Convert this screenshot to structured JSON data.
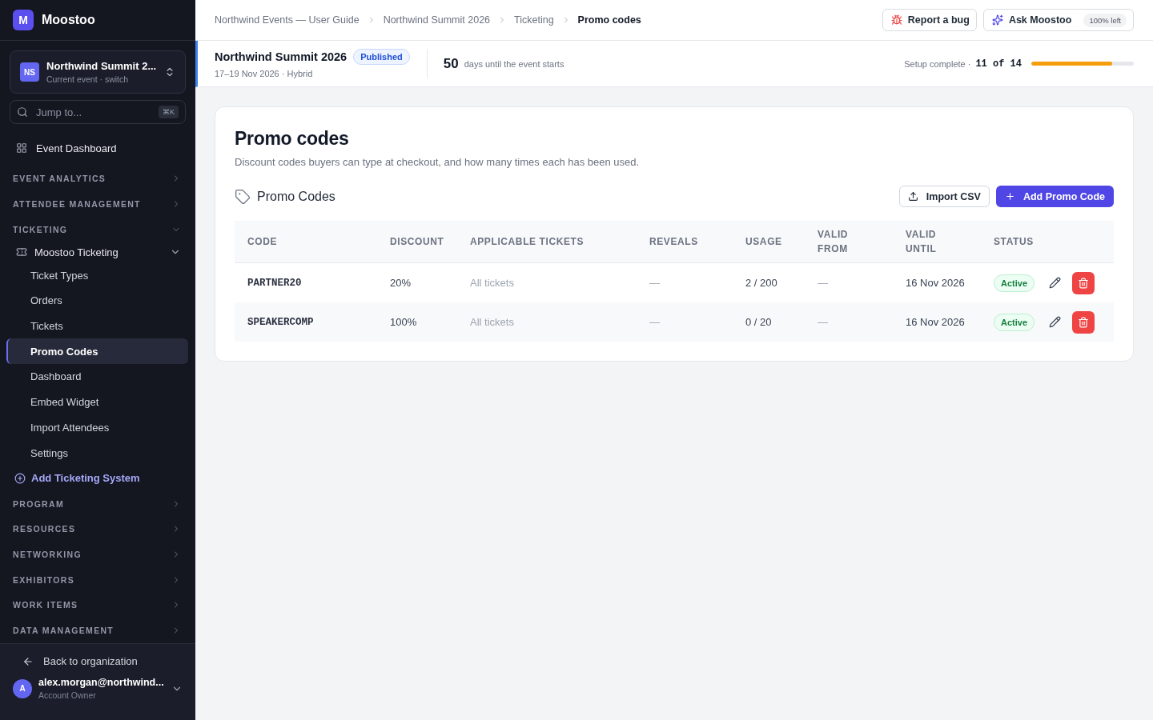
{
  "sidebar": {
    "brand": {
      "initial": "M",
      "name": "Moostoo"
    },
    "event_switcher": {
      "initials": "NS",
      "name": "Northwind Summit 2...",
      "caption": "Current event · switch"
    },
    "search": {
      "placeholder": "Jump to...",
      "shortcut": "⌘K"
    },
    "top_item": {
      "label": "Event Dashboard"
    },
    "sections": [
      {
        "label": "EVENT ANALYTICS",
        "expanded": false
      },
      {
        "label": "ATTENDEE MANAGEMENT",
        "expanded": false
      },
      {
        "label": "TICKETING",
        "expanded": true,
        "groups": [
          {
            "label": "Moostoo Ticketing",
            "expanded": true,
            "children": [
              {
                "label": "Ticket Types",
                "selected": false
              },
              {
                "label": "Orders",
                "selected": false
              },
              {
                "label": "Tickets",
                "selected": false
              },
              {
                "label": "Promo Codes",
                "selected": true
              },
              {
                "label": "Dashboard",
                "selected": false
              },
              {
                "label": "Embed Widget",
                "selected": false
              },
              {
                "label": "Import Attendees",
                "selected": false
              },
              {
                "label": "Settings",
                "selected": false
              }
            ]
          }
        ],
        "action": "Add Ticketing System"
      },
      {
        "label": "PROGRAM",
        "expanded": false
      },
      {
        "label": "RESOURCES",
        "expanded": false
      },
      {
        "label": "NETWORKING",
        "expanded": false
      },
      {
        "label": "EXHIBITORS",
        "expanded": false
      },
      {
        "label": "WORK ITEMS",
        "expanded": false
      },
      {
        "label": "DATA MANAGEMENT",
        "expanded": false
      }
    ],
    "footer": {
      "back": "Back to organization",
      "user": {
        "initial": "A",
        "email": "alex.morgan@northwind...",
        "role": "Account Owner"
      }
    }
  },
  "breadcrumbs": [
    "Northwind Events — User Guide",
    "Northwind Summit 2026",
    "Ticketing",
    "Promo codes"
  ],
  "header_actions": {
    "report": "Report a bug",
    "ask": "Ask Moostoo",
    "ask_badge": "100% left"
  },
  "event_bar": {
    "title": "Northwind Summit 2026",
    "status": "Published",
    "dates": "17–19 Nov 2026 · Hybrid",
    "days": "50",
    "days_label": "days until the event starts",
    "setup_label": "Setup complete ·",
    "setup_count": "11 of 14",
    "level": 0.786
  },
  "page": {
    "title": "Promo codes",
    "description": "Discount codes buyers can type at checkout, and how many times each has been used.",
    "section_title": "Promo Codes",
    "import_button": "Import CSV",
    "add_button": "Add Promo Code",
    "table": {
      "columns": [
        "CODE",
        "DISCOUNT",
        "APPLICABLE TICKETS",
        "REVEALS",
        "USAGE",
        "VALID FROM",
        "VALID UNTIL",
        "STATUS"
      ],
      "rows": [
        {
          "code": "PARTNER20",
          "discount": "20%",
          "tickets": "All tickets",
          "reveals": "—",
          "usage": "2 / 200",
          "valid_from": "—",
          "valid_until": "16 Nov 2026",
          "status": "Active"
        },
        {
          "code": "SPEAKERCOMP",
          "discount": "100%",
          "tickets": "All tickets",
          "reveals": "—",
          "usage": "0 / 20",
          "valid_from": "—",
          "valid_until": "16 Nov 2026",
          "status": "Active"
        }
      ]
    }
  }
}
